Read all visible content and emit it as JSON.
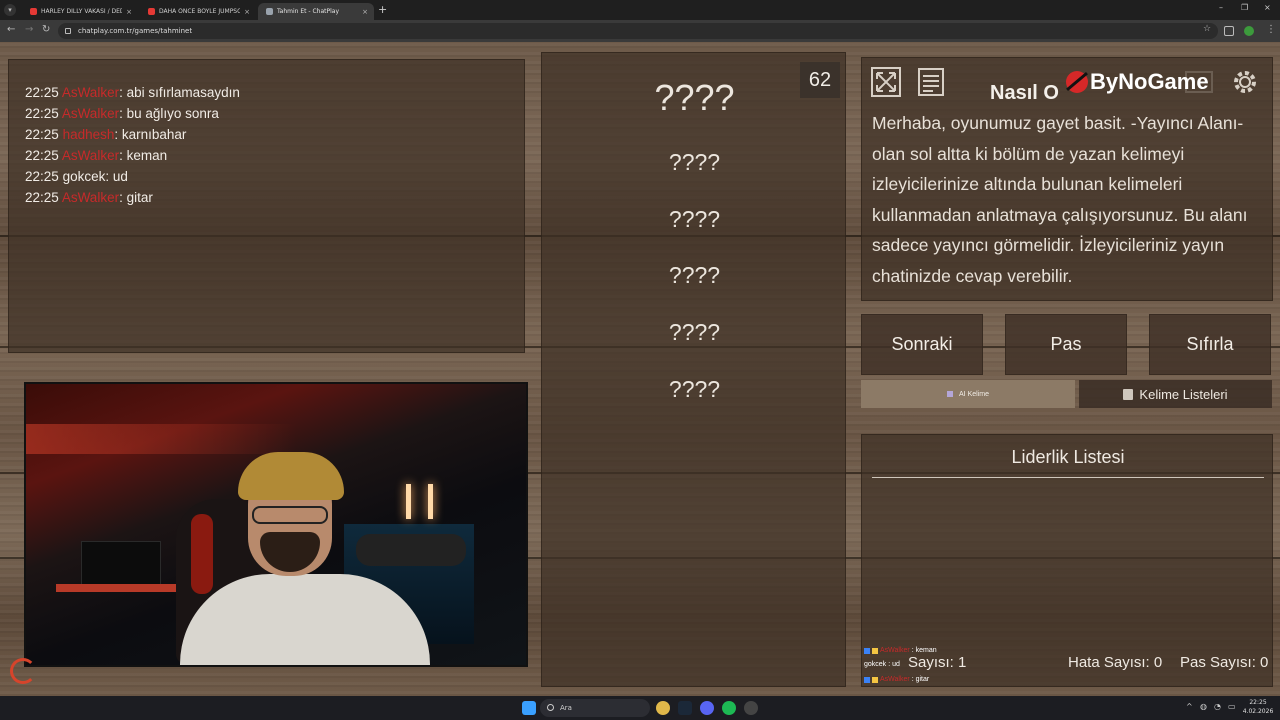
{
  "browser": {
    "tabs": [
      {
        "title": "HARLEY DILLY VAKASI / DEDER",
        "icon": "youtube-icon"
      },
      {
        "title": "DAHA ÖNCE BÖYLE JUMPSCAR",
        "icon": "youtube-icon"
      },
      {
        "title": "Tahmin Et - ChatPlay",
        "icon": "chatplay-icon"
      }
    ],
    "url": "chatplay.com.tr/games/tahminet",
    "new_tab": "+",
    "close": "×",
    "win_minimize": "–",
    "win_maximize": "❐",
    "win_close": "×"
  },
  "chat": {
    "messages": [
      {
        "time": "22:25",
        "user": "AsWalker",
        "user_color": "#c62a2a",
        "text": ": abi sıfırlamasaydın"
      },
      {
        "time": "22:25",
        "user": "AsWalker",
        "user_color": "#c62a2a",
        "text": ": bu ağlıyo sonra"
      },
      {
        "time": "22:25",
        "user": "hadhesh",
        "user_color": "#c62a2a",
        "text": ": karnıbahar"
      },
      {
        "time": "22:25",
        "user": "AsWalker",
        "user_color": "#c62a2a",
        "text": ": keman"
      },
      {
        "time": "22:25",
        "user": "gokcek",
        "user_color": "#f1ece6",
        "text": ": ud"
      },
      {
        "time": "22:25",
        "user": "AsWalker",
        "user_color": "#c62a2a",
        "text": ": gitar"
      }
    ]
  },
  "game": {
    "timer": "62",
    "words": [
      "????",
      "????",
      "????",
      "????",
      "????",
      "????"
    ]
  },
  "howto": {
    "title": "Nasıl O",
    "text": "Merhaba, oyunumuz gayet basit. -Yayıncı Alanı- olan sol altta ki bölüm de yazan kelimeyi izleyicilerinize altında bulunan kelimeleri kullanmadan anlatmaya çalışıyorsunuz. Bu alanı sadece yayıncı görmelidir. İzleyicileriniz yayın chatinizde cevap verebilir."
  },
  "logo": {
    "text": "ByNoGame"
  },
  "buttons": {
    "next": "Sonraki",
    "pass": "Pas",
    "reset": "Sıfırla"
  },
  "tabs": {
    "ai": "AI Kelime",
    "lists": "Kelime Listeleri"
  },
  "leaderboard": {
    "title": "Liderlik Listesi",
    "score_label": "Sayısı: 1",
    "error_label": "Hata Sayısı: 0",
    "pass_label": "Pas Sayısı: 0"
  },
  "overlay_chat": [
    {
      "user": "AsWalker",
      "text": ": keman"
    },
    {
      "user": "gokcek",
      "text": ": ud"
    },
    {
      "user": "AsWalker",
      "text": ": gitar"
    }
  ],
  "taskbar": {
    "search_placeholder": "Ara",
    "time": "22:25",
    "date": "4.02.2026"
  },
  "colors": {
    "accent_red": "#c62a2a",
    "wood": "#6d5a49",
    "panel": "#3e3026"
  }
}
